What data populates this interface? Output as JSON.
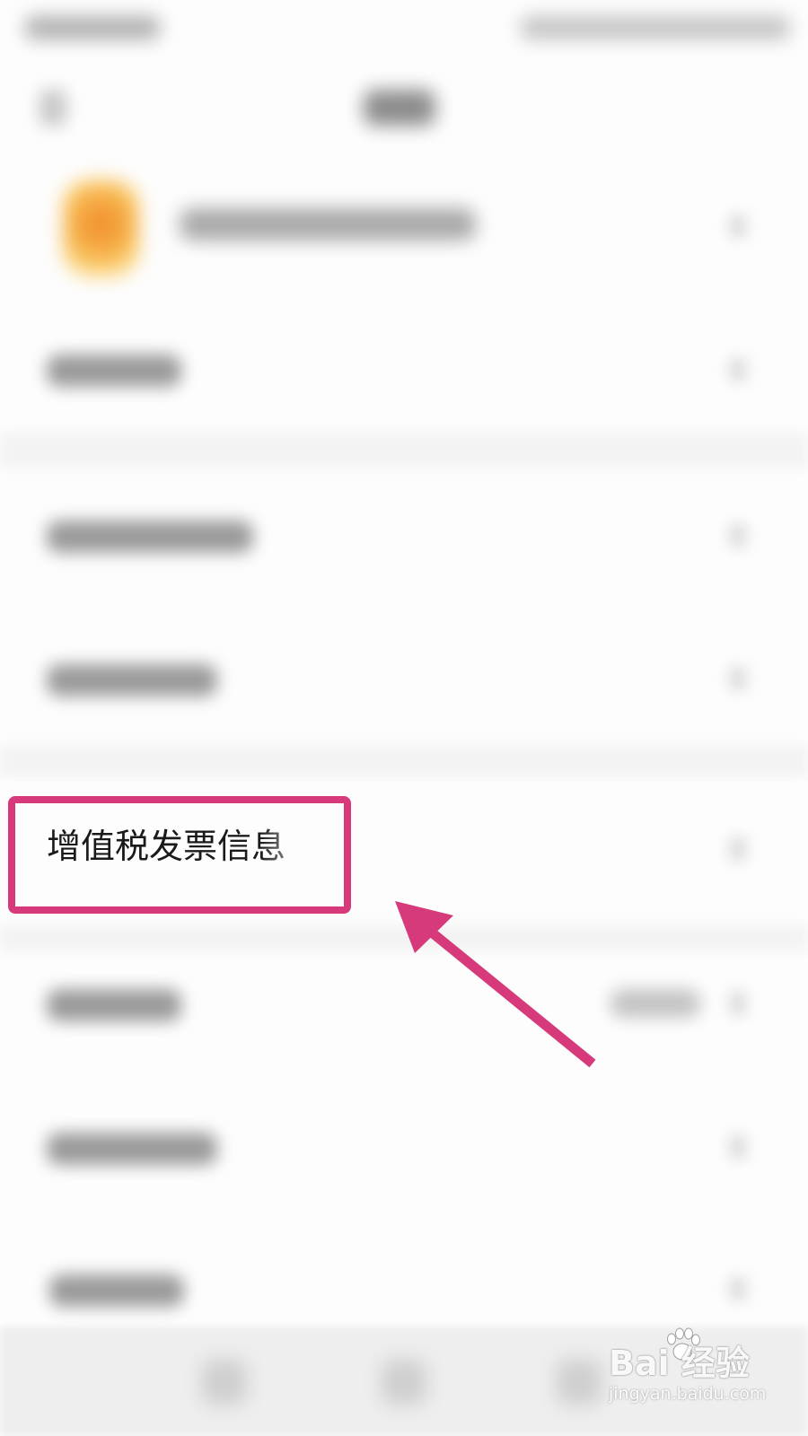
{
  "highlight": {
    "label": "增值税发票信息",
    "color": "#d63a7a"
  },
  "watermark": {
    "brand": "Bai  经验",
    "url": "jingyan.baidu.com",
    "paw_icon": "paw-icon"
  },
  "annotation": {
    "arrow_color": "#d63a7a",
    "icon": "arrow-up-left-icon"
  }
}
